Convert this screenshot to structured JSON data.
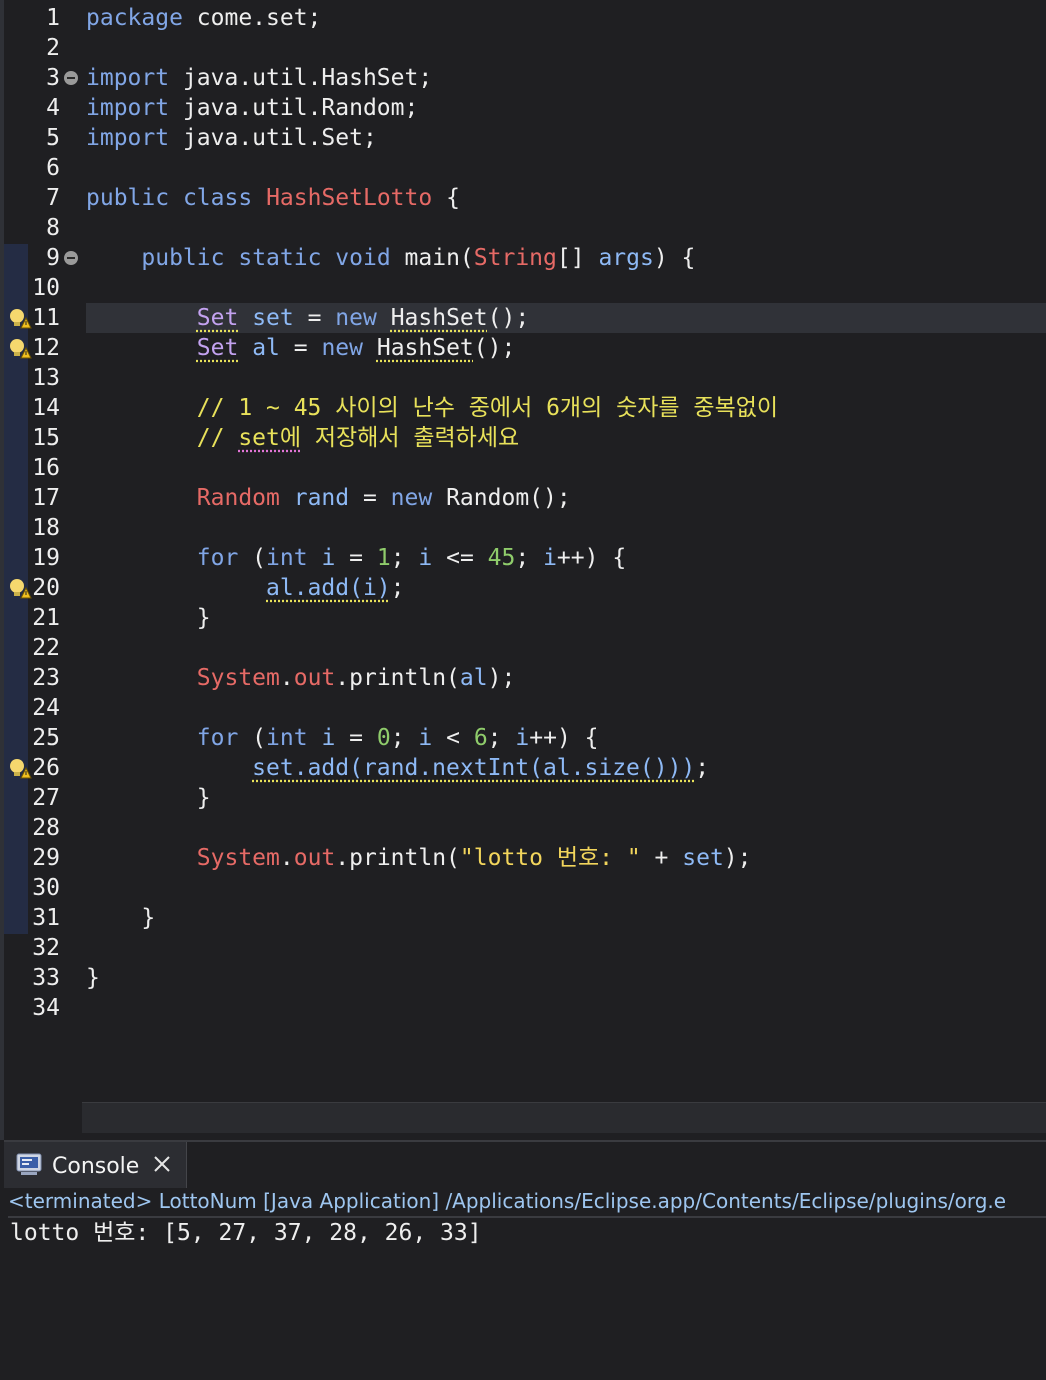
{
  "editor": {
    "line_numbers": [
      "1",
      "2",
      "3",
      "4",
      "5",
      "6",
      "7",
      "8",
      "9",
      "10",
      "11",
      "12",
      "13",
      "14",
      "15",
      "16",
      "17",
      "18",
      "19",
      "20",
      "21",
      "22",
      "23",
      "24",
      "25",
      "26",
      "27",
      "28",
      "29",
      "30",
      "31",
      "32",
      "33",
      "34"
    ],
    "tokens": {
      "kw_package": "package",
      "pkg_name": " come.set;",
      "kw_import": "import",
      "imp_hashset": " java.util.HashSet;",
      "imp_random": " java.util.Random;",
      "imp_set": " java.util.Set;",
      "kw_public": "public",
      "kw_class": "class",
      "class_name": "HashSetLotto",
      "brace_open": " {",
      "kw_static": "static",
      "kw_void": "void",
      "m_main": "main(",
      "t_string": "String",
      "brackets": "[] ",
      "p_args": "args",
      "paren_brace": ") {",
      "t_set": "Set",
      "v_set": "set",
      "v_al": "al",
      "eq": " = ",
      "kw_new": "new",
      "c_hashset": "HashSet",
      "call_end": "();",
      "comment1": "// 1 ~ 45 사이의 난수 중에서 6개의 숫자를 중복없이",
      "comment2_a": "// ",
      "comment2_b": "set에",
      "comment2_c": " 저장해서 출력하세요",
      "c_random": "Random",
      "v_rand": "rand",
      "kw_for": "for",
      "paren_open": " (",
      "kw_int": "int",
      "v_i": "i",
      "n_1": "1",
      "n_45": "45",
      "n_0": "0",
      "n_6": "6",
      "semi": "; ",
      "le": " <= ",
      "lt": " < ",
      "inc": "++",
      "close_brace": "}",
      "al_add_i": "al.add(i)",
      "semicolon": ";",
      "c_system": "System",
      "dot": ".",
      "f_out": "out",
      "println": ".println(",
      "println_al_end": ");",
      "add_stmt": "set.add(rand.nextInt(al.size()))",
      "str_lotto": "\"lotto 번호: \"",
      "plus": " + ",
      "println_set_end": ");"
    }
  },
  "console": {
    "tab_label": "Console",
    "status": "<terminated> LottoNum [Java Application] /Applications/Eclipse.app/Contents/Eclipse/plugins/org.e",
    "output": "lotto 번호: [5, 27, 37, 28, 26, 33]"
  }
}
